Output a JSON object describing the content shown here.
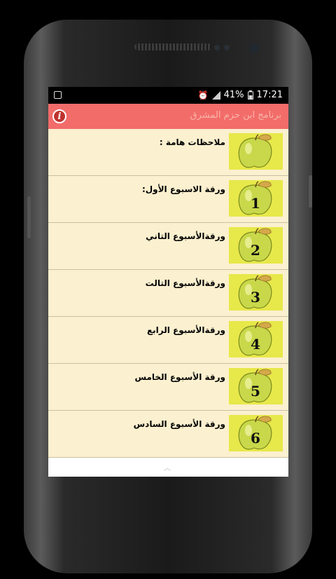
{
  "status_bar": {
    "battery": "41%",
    "time": "17:21"
  },
  "header": {
    "title": "برنامج ابن حزم المشرق"
  },
  "list": {
    "items": [
      {
        "label": "ملاحظات هامة :",
        "badge": ""
      },
      {
        "label": "ورقة الاسبوع الأول:",
        "badge": "1"
      },
      {
        "label": "ورقةالأسبوع التاني",
        "badge": "2"
      },
      {
        "label": "ورقةالأسبوع التالت",
        "badge": "3"
      },
      {
        "label": "ورقةالأسبوع الرابع",
        "badge": "4"
      },
      {
        "label": "ورقة الأسبوع الخامس",
        "badge": "5"
      },
      {
        "label": "ورقة الأسبوع السادس",
        "badge": "6"
      }
    ]
  },
  "icons": {
    "app_notification": "image-icon",
    "alarm": "alarm-icon",
    "signal": "signal-icon",
    "battery": "battery-icon",
    "info": "info-icon",
    "scroll": "chevron-up-icon",
    "thumbnail": "apple-icon"
  },
  "colors": {
    "header": "#f26c6a",
    "row_bg": "#fbf0cf",
    "thumb_bg": "#e7e84a",
    "apple": "#c8d84a"
  }
}
